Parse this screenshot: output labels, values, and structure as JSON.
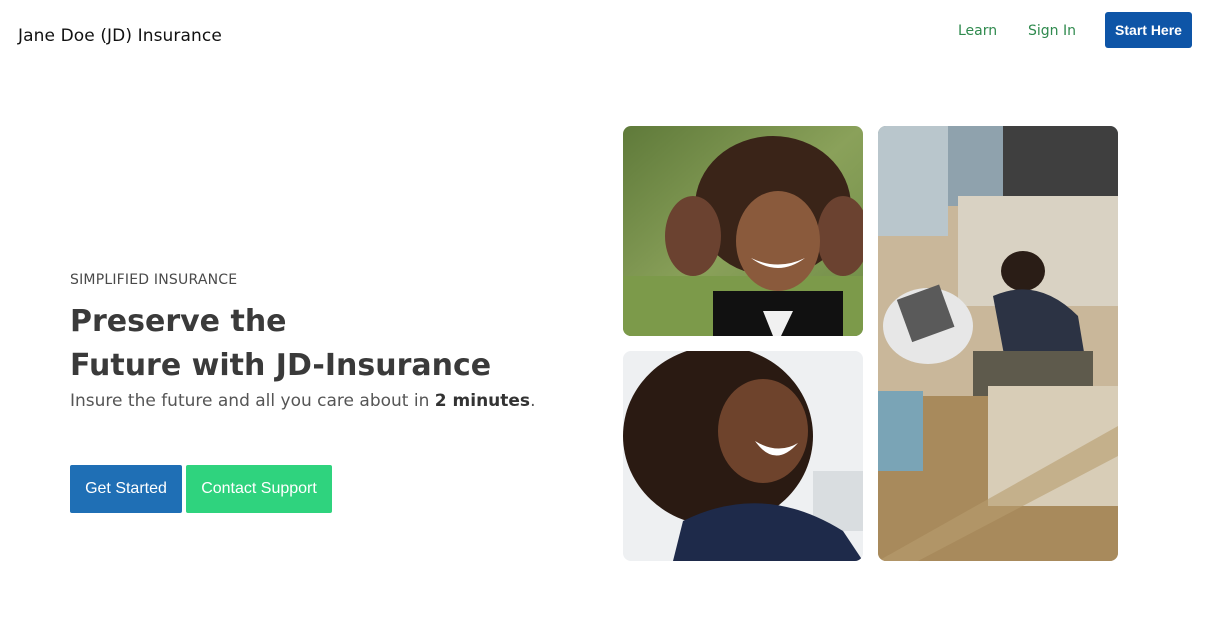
{
  "header": {
    "brand": "Jane Doe (JD) Insurance",
    "nav": {
      "learn": "Learn",
      "sign_in": "Sign In"
    },
    "cta": "Start Here"
  },
  "hero": {
    "eyebrow": "SIMPLIFIED INSURANCE",
    "headline_line1": "Preserve the",
    "headline_line2": "Future with JD-Insurance",
    "subtext_before": "Insure the future and all you care about in ",
    "subtext_bold": "2 minutes",
    "subtext_after": ".",
    "primary_button": "Get Started",
    "secondary_button": "Contact Support"
  },
  "colors": {
    "nav_link": "#2f8a4e",
    "cta_bg": "#0e55a7",
    "primary_button_bg": "#1f6fb5",
    "secondary_button_bg": "#2fd37e"
  },
  "images": [
    {
      "name": "child-smiling-photo"
    },
    {
      "name": "woman-laughing-photo"
    },
    {
      "name": "man-with-laptop-photo"
    }
  ]
}
